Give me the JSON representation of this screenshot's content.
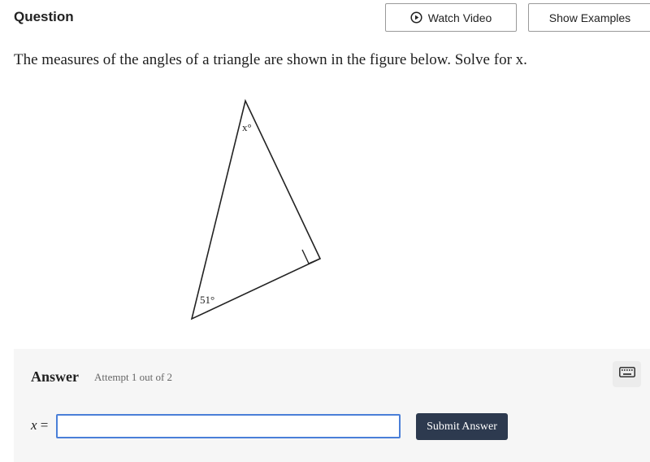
{
  "header": {
    "title": "Question",
    "watch_video_label": "Watch Video",
    "show_examples_label": "Show Examples"
  },
  "question": {
    "prompt": "The measures of the angles of a triangle are shown in the figure below. Solve for x."
  },
  "figure": {
    "top_angle_label": "x°",
    "bottom_angle_label": "51°",
    "right_angle_marker": true
  },
  "answer": {
    "label": "Answer",
    "attempt_text": "Attempt 1 out of 2",
    "variable": "x",
    "equals": "=",
    "input_value": "",
    "input_placeholder": "",
    "submit_label": "Submit Answer"
  },
  "icons": {
    "watch_video": "play-circle-icon",
    "keyboard": "keyboard-icon"
  },
  "colors": {
    "submit_bg": "#2d3a4f",
    "input_border": "#4a7fd8",
    "panel_bg": "#f6f6f6"
  }
}
